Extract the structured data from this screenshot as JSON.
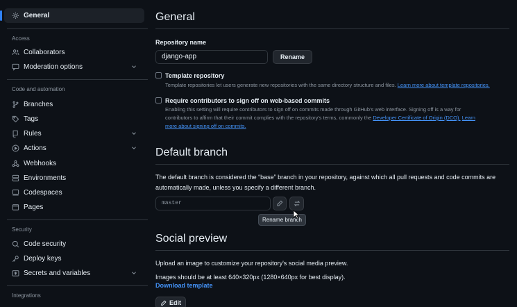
{
  "sidebar": {
    "general": "General",
    "sections": {
      "access": "Access",
      "code_automation": "Code and automation",
      "security": "Security",
      "integrations": "Integrations"
    },
    "items": {
      "collaborators": "Collaborators",
      "moderation": "Moderation options",
      "branches": "Branches",
      "tags": "Tags",
      "rules": "Rules",
      "actions": "Actions",
      "webhooks": "Webhooks",
      "environments": "Environments",
      "codespaces": "Codespaces",
      "pages": "Pages",
      "code_security": "Code security",
      "deploy_keys": "Deploy keys",
      "secrets": "Secrets and variables"
    }
  },
  "general": {
    "title": "General",
    "repo_name_label": "Repository name",
    "repo_name_value": "django-app",
    "rename_button": "Rename",
    "template": {
      "label": "Template repository",
      "desc": "Template repositories let users generate new repositories with the same directory structure and files.",
      "link": "Learn more about template repositories."
    },
    "signoff": {
      "label": "Require contributors to sign off on web-based commits",
      "desc_line1": "Enabling this setting will require contributors to sign off on commits made through GitHub's web interface. Signing off is a way for",
      "desc_line2_pre": "contributors to affirm that their commit complies with the repository's terms, commonly the ",
      "link1": "Developer Certificate of Origin (DCO).",
      "link2_a": "Learn",
      "link2_b": "more about signing off on commits."
    }
  },
  "default_branch": {
    "title": "Default branch",
    "desc_line1": "The default branch is considered the “base” branch in your repository, against which all pull requests and code commits are",
    "desc_line2": "automatically made, unless you specify a different branch.",
    "branch_value": "master",
    "tooltip": "Rename branch"
  },
  "social_preview": {
    "title": "Social preview",
    "desc": "Upload an image to customize your repository's social media preview.",
    "size_note": "Images should be at least 640×320px (1280×640px for best display).",
    "download_link": "Download template",
    "edit_button": "Edit"
  }
}
